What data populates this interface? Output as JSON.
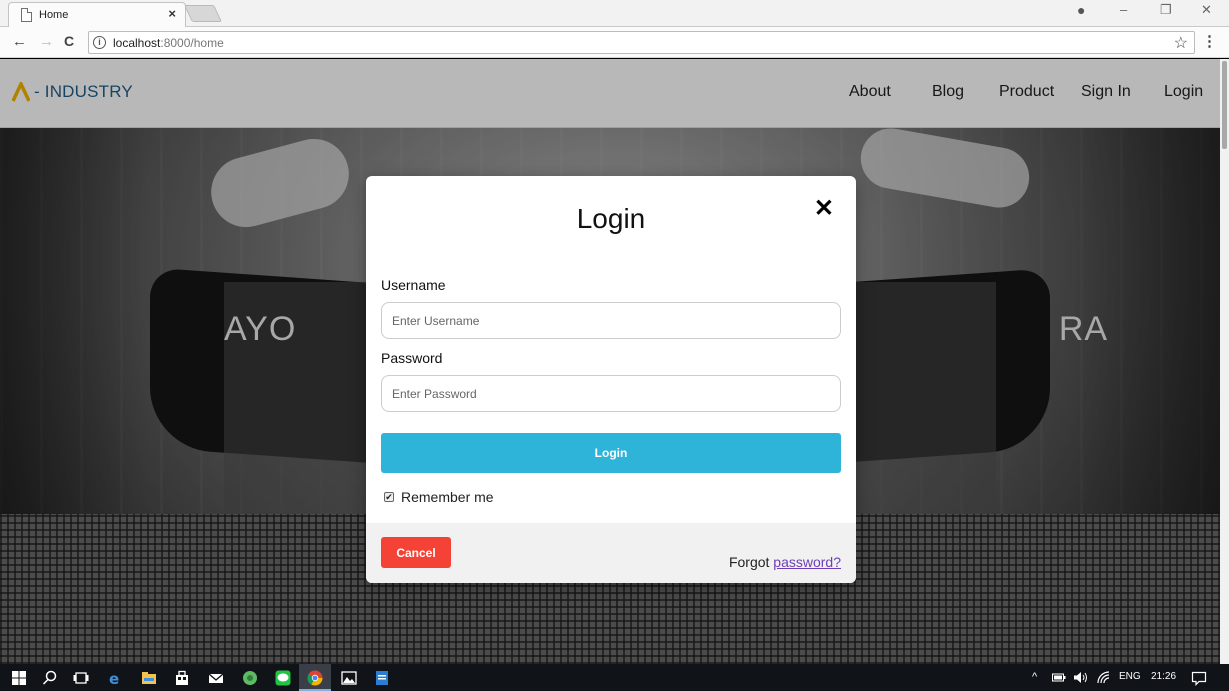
{
  "browser": {
    "tab_title": "Home",
    "tab_close": "×",
    "window_controls": {
      "minimize": "–",
      "restore": "❐",
      "close": "✕"
    },
    "account_icon": "●",
    "nav": {
      "back": "←",
      "forward": "→",
      "reload": "C"
    },
    "url_host": "localhost",
    "url_rest": ":8000/home",
    "info_icon": "i",
    "star_icon": "☆",
    "menu_icon": "⋮"
  },
  "site": {
    "brand_mark_color": "#f5b400",
    "brand_text": "- INDUSTRY",
    "nav": [
      "About",
      "Blog",
      "Product",
      "Sign In",
      "Login"
    ],
    "hero_title": "AYO                                                                         RA"
  },
  "modal": {
    "title": "Login",
    "close": "✕",
    "username_label": "Username",
    "username_placeholder": "Enter Username",
    "password_label": "Password",
    "password_placeholder": "Enter Password",
    "login_button": "Login",
    "remember_checked": true,
    "remember_label": "Remember me",
    "cancel_button": "Cancel",
    "forgot_prefix": "Forgot ",
    "forgot_link": "password?",
    "colors": {
      "login_button": "#2eb3d9",
      "cancel_button": "#f44336",
      "link": "#6c3fb5"
    }
  },
  "taskbar": {
    "tray": {
      "language": "ENG",
      "time": "21:26",
      "chevron": "^"
    }
  }
}
